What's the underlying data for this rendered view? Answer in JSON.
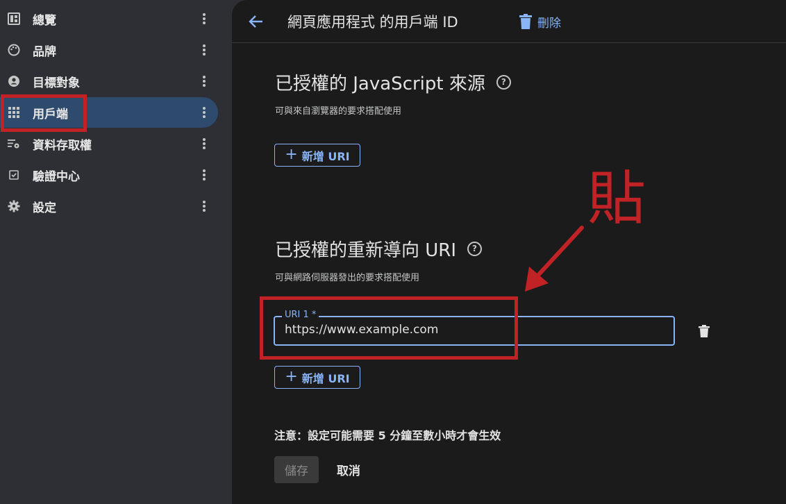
{
  "sidebar": {
    "items": [
      {
        "label": "總覽",
        "icon": "dashboard-icon"
      },
      {
        "label": "品牌",
        "icon": "palette-icon"
      },
      {
        "label": "目標對象",
        "icon": "person-icon"
      },
      {
        "label": "用戶端",
        "icon": "grid-icon",
        "active": true
      },
      {
        "label": "資料存取權",
        "icon": "data-settings-icon"
      },
      {
        "label": "驗證中心",
        "icon": "check-box-icon"
      },
      {
        "label": "設定",
        "icon": "gear-icon"
      }
    ]
  },
  "header": {
    "title": "網頁應用程式 的用戶端 ID",
    "delete_label": "刪除"
  },
  "js_origins": {
    "title": "已授權的 JavaScript 來源",
    "help": "?",
    "description": "可與來自瀏覽器的要求搭配使用",
    "add_label": "新增 URI"
  },
  "redirect_uris": {
    "title": "已授權的重新導向 URI",
    "help": "?",
    "description": "可與網路伺服器發出的要求搭配使用",
    "field_label": "URI 1 *",
    "field_value": "https://www.example.com",
    "add_label": "新增 URI"
  },
  "footer": {
    "note": "注意：設定可能需要 5 分鐘至數小時才會生效",
    "save_label": "儲存",
    "cancel_label": "取消"
  },
  "annotation": {
    "text": "貼",
    "color": "#c02226"
  },
  "colors": {
    "accent": "#8ab4f8",
    "active_nav": "#2e4a6d",
    "annotation": "#c02226"
  }
}
